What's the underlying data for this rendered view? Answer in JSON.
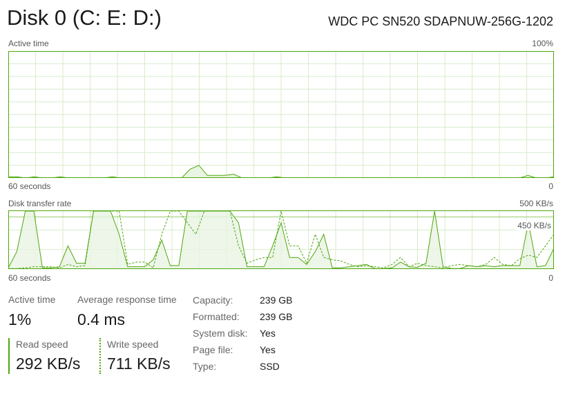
{
  "header": {
    "title": "Disk 0 (C: E: D:)",
    "model": "WDC PC SN520 SDAPNUW-256G-1202"
  },
  "active_time_graph": {
    "label": "Active time",
    "max_label": "100%",
    "time_label": "60 seconds",
    "min_label": "0",
    "values": [
      1,
      1,
      0,
      1,
      0,
      0,
      1,
      0,
      0,
      0,
      0,
      0,
      1,
      0,
      0,
      0,
      0,
      0,
      0,
      0,
      0,
      7,
      10,
      2,
      2,
      2,
      3,
      0,
      0,
      0,
      0,
      1,
      0,
      0,
      0,
      0,
      0,
      0,
      0,
      0,
      0,
      0,
      0,
      0,
      0,
      0,
      0,
      0,
      0,
      0,
      0,
      0,
      0,
      0,
      0,
      0,
      0,
      0,
      0,
      0,
      2,
      0,
      0,
      1
    ]
  },
  "transfer_graph": {
    "label": "Disk transfer rate",
    "max_label": "500 KB/s",
    "secondary_label": "450 KB/s",
    "time_label": "60 seconds",
    "min_label": "0",
    "read_values": [
      10,
      150,
      500,
      500,
      10,
      10,
      20,
      200,
      50,
      50,
      500,
      500,
      500,
      300,
      20,
      20,
      20,
      80,
      250,
      30,
      30,
      500,
      500,
      500,
      500,
      500,
      500,
      400,
      20,
      20,
      20,
      200,
      400,
      100,
      100,
      40,
      150,
      300,
      10,
      10,
      20,
      30,
      40,
      5,
      5,
      10,
      60,
      20,
      15,
      50,
      500,
      20,
      5,
      5,
      30,
      20,
      30,
      20,
      30,
      30,
      30,
      400,
      20,
      30,
      180
    ],
    "write_values": [
      5,
      5,
      10,
      20,
      20,
      20,
      10,
      40,
      20,
      30,
      500,
      500,
      500,
      500,
      40,
      60,
      60,
      10,
      300,
      500,
      500,
      400,
      300,
      500,
      500,
      500,
      500,
      200,
      50,
      80,
      100,
      100,
      500,
      200,
      200,
      50,
      300,
      100,
      80,
      70,
      40,
      20,
      30,
      20,
      10,
      40,
      100,
      20,
      50,
      30,
      20,
      10,
      30,
      40,
      30,
      20,
      40,
      100,
      40,
      30,
      90,
      120,
      100,
      200,
      300
    ]
  },
  "stats": {
    "active_time_label": "Active time",
    "active_time_value": "1%",
    "avg_response_label": "Average response time",
    "avg_response_value": "0.4 ms",
    "read_speed_label": "Read speed",
    "read_speed_value": "292 KB/s",
    "write_speed_label": "Write speed",
    "write_speed_value": "711 KB/s"
  },
  "properties": [
    {
      "label": "Capacity:",
      "value": "239 GB"
    },
    {
      "label": "Formatted:",
      "value": "239 GB"
    },
    {
      "label": "System disk:",
      "value": "Yes"
    },
    {
      "label": "Page file:",
      "value": "Yes"
    },
    {
      "label": "Type:",
      "value": "SSD"
    }
  ],
  "colors": {
    "accent": "#4da60c",
    "fill": "#e9f4e2",
    "grid": "#d8ebcb"
  }
}
